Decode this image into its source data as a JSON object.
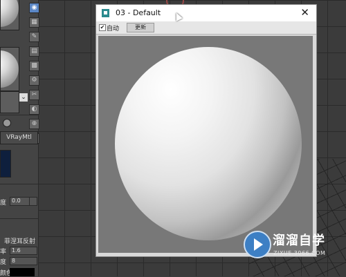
{
  "dialog": {
    "title": "03 - Default",
    "close_glyph": "✕",
    "auto_checkbox": {
      "checked_glyph": "✔",
      "label": "自动"
    },
    "update_button": "更新"
  },
  "left_panel": {
    "toolbar_glyphs": [
      "◉",
      "▦",
      "✎",
      "▤",
      "▩",
      "⚙",
      "✂",
      "◐",
      "⊕",
      "◍"
    ],
    "chevron": "⌄",
    "material_type": "VRayMtl",
    "param_label_depth": "度",
    "param_value_depth": "0.0",
    "section_label": "菲涅耳反射",
    "row_labels": [
      "率",
      "度",
      "颜色"
    ],
    "row_values": [
      "1.6",
      "8"
    ]
  },
  "watermark": {
    "title": "溜溜自学",
    "subtitle": "ZIXUE.3066.COM"
  },
  "colors": {
    "diffuse_swatch": "#0e1f3d",
    "accent_active": "#5b87c6"
  }
}
